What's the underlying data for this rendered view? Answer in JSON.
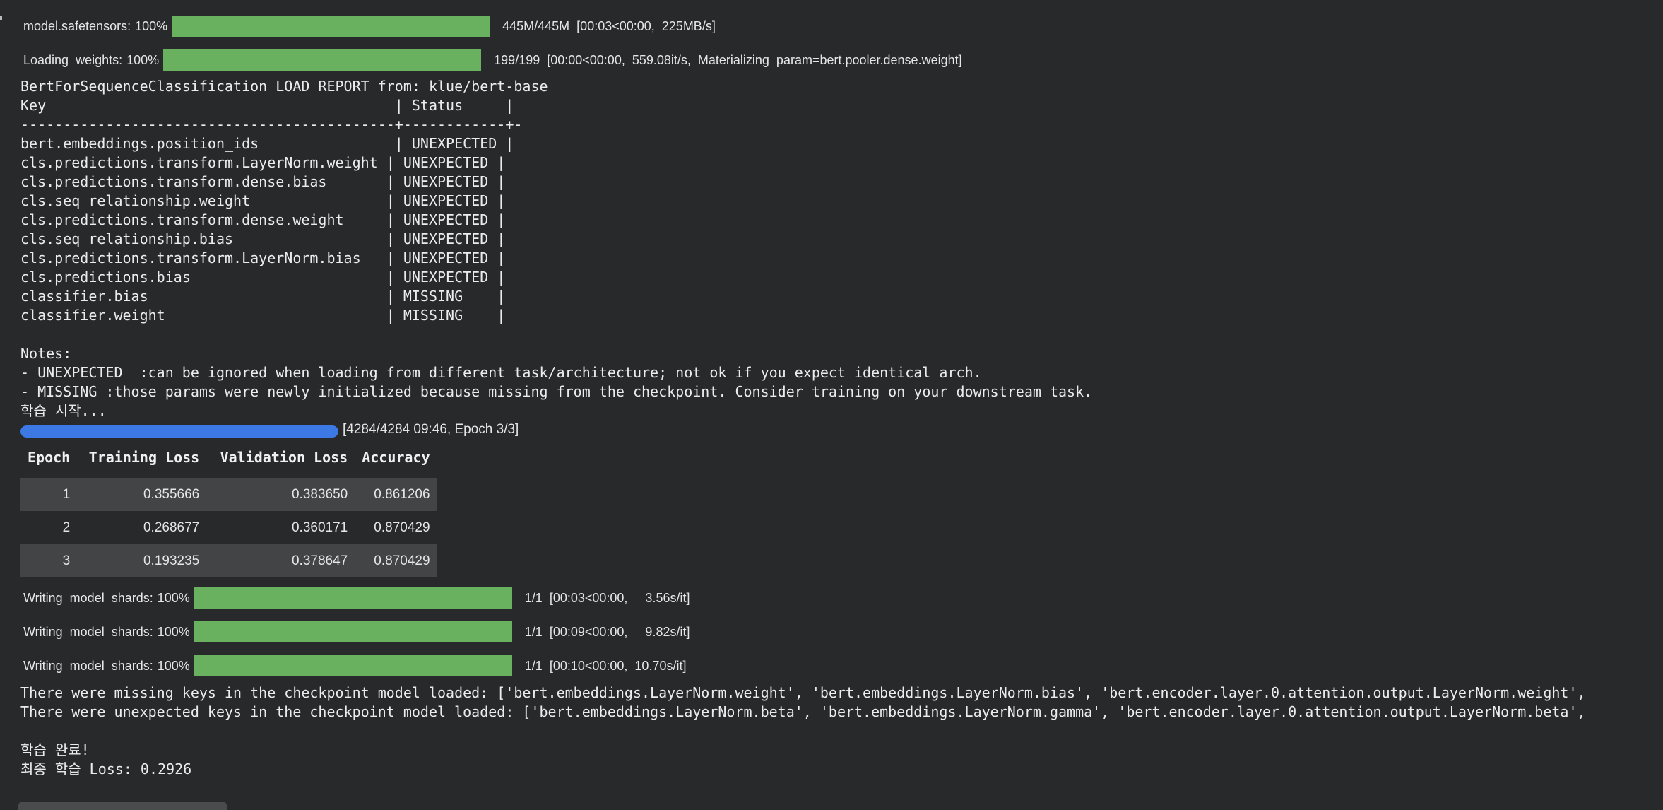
{
  "progress_bars": [
    {
      "label": "model.safetensors:",
      "percent": "100%",
      "fraction": 1.0,
      "info": "445M/445M  [00:03<00:00,  225MB/s]"
    },
    {
      "label": "Loading  weights:",
      "percent": "100%",
      "fraction": 1.0,
      "info": "199/199  [00:00<00:00,  559.08it/s,  Materializing  param=bert.pooler.dense.weight]"
    }
  ],
  "report": {
    "title": "BertForSequenceClassification LOAD REPORT from: klue/bert-base",
    "header": "Key                                         | Status     |",
    "divider": "--------------------------------------------+------------+-",
    "rows": [
      "bert.embeddings.position_ids                | UNEXPECTED |",
      "cls.predictions.transform.LayerNorm.weight | UNEXPECTED |",
      "cls.predictions.transform.dense.bias       | UNEXPECTED |",
      "cls.seq_relationship.weight                | UNEXPECTED |",
      "cls.predictions.transform.dense.weight     | UNEXPECTED |",
      "cls.seq_relationship.bias                  | UNEXPECTED |",
      "cls.predictions.transform.LayerNorm.bias   | UNEXPECTED |",
      "cls.predictions.bias                       | UNEXPECTED |",
      "classifier.bias                            | MISSING    |",
      "classifier.weight                          | MISSING    |"
    ],
    "notes_title": "Notes:",
    "notes": [
      "- UNEXPECTED  :can be ignored when loading from different task/architecture; not ok if you expect identical arch.",
      "- MISSING :those params were newly initialized because missing from the checkpoint. Consider training on your downstream task."
    ],
    "train_start": "학습 시작..."
  },
  "training_progress": {
    "fraction": 1.0,
    "info": "[4284/4284 09:46, Epoch 3/3]"
  },
  "metrics_table": {
    "columns": [
      "Epoch",
      "Training Loss",
      "Validation Loss",
      "Accuracy"
    ],
    "rows": [
      [
        "1",
        "0.355666",
        "0.383650",
        "0.861206"
      ],
      [
        "2",
        "0.268677",
        "0.360171",
        "0.870429"
      ],
      [
        "3",
        "0.193235",
        "0.378647",
        "0.870429"
      ]
    ]
  },
  "shard_bars": [
    {
      "label": "Writing  model  shards:",
      "percent": "100%",
      "fraction": 1.0,
      "info": "1/1  [00:03<00:00,     3.56s/it]"
    },
    {
      "label": "Writing  model  shards:",
      "percent": "100%",
      "fraction": 1.0,
      "info": "1/1  [00:09<00:00,     9.82s/it]"
    },
    {
      "label": "Writing  model  shards:",
      "percent": "100%",
      "fraction": 1.0,
      "info": "1/1  [00:10<00:00,  10.70s/it]"
    }
  ],
  "final_output": {
    "missing_keys": "There were missing keys in the checkpoint model loaded: ['bert.embeddings.LayerNorm.weight', 'bert.embeddings.LayerNorm.bias', 'bert.encoder.layer.0.attention.output.LayerNorm.weight',",
    "unexpected_keys": "There were unexpected keys in the checkpoint model loaded: ['bert.embeddings.LayerNorm.beta', 'bert.embeddings.LayerNorm.gamma', 'bert.encoder.layer.0.attention.output.LayerNorm.beta',",
    "done": "학습 완료!",
    "final_loss": "최종 학습 Loss: 0.2926"
  },
  "colors": {
    "background": "#28292b",
    "progress_green": "#69b15e",
    "progress_blue": "#3d79e4",
    "table_stripe": "#434446"
  }
}
